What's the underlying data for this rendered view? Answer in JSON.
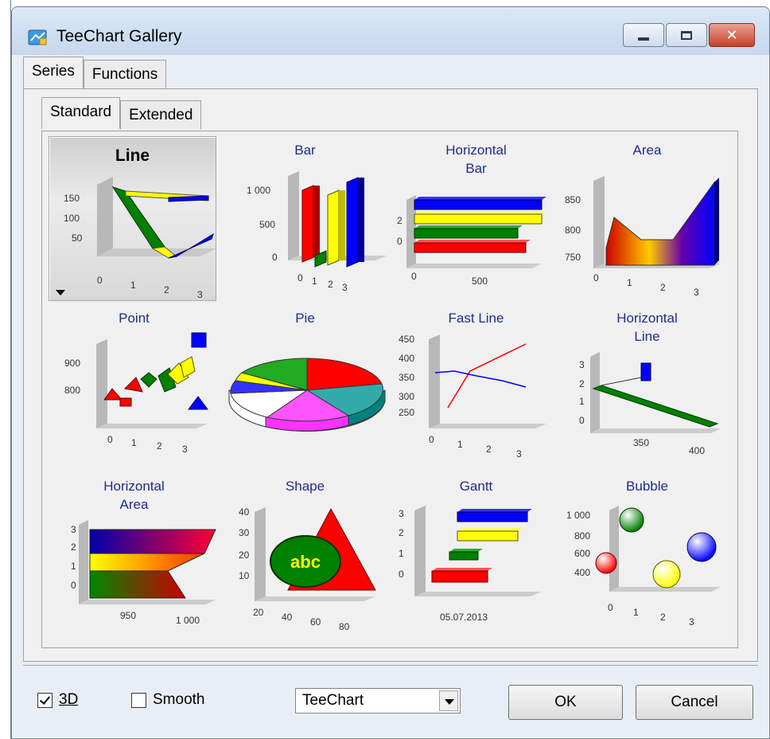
{
  "window": {
    "title": "TeeChart Gallery"
  },
  "caption_buttons": {
    "close": "✕"
  },
  "tabs_main": [
    {
      "label": "Series",
      "active": true
    },
    {
      "label": "Functions",
      "active": false
    }
  ],
  "tabs_sub": [
    {
      "label": "Standard",
      "active": true
    },
    {
      "label": "Extended",
      "active": false
    }
  ],
  "gallery": [
    {
      "name": "Line",
      "selected": true
    },
    {
      "name": "Bar"
    },
    {
      "name": "Horizontal\nBar"
    },
    {
      "name": "Area"
    },
    {
      "name": "Point"
    },
    {
      "name": "Pie"
    },
    {
      "name": "Fast Line"
    },
    {
      "name": "Horizontal\nLine"
    },
    {
      "name": "Horizontal\nArea"
    },
    {
      "name": "Shape"
    },
    {
      "name": "Gantt"
    },
    {
      "name": "Bubble"
    }
  ],
  "thumb_labels": {
    "line": {
      "y": [
        "150",
        "100",
        "50"
      ],
      "x": [
        "0",
        "1",
        "2",
        "3"
      ]
    },
    "bar": {
      "y": [
        "1 000",
        "500",
        "0"
      ],
      "x": [
        "0",
        "1",
        "2",
        "3"
      ]
    },
    "hbar": {
      "y": [
        "2",
        "0"
      ],
      "x": [
        "0",
        "500"
      ]
    },
    "area": {
      "y": [
        "850",
        "800",
        "750"
      ],
      "x": [
        "0",
        "1",
        "2",
        "3"
      ]
    },
    "point": {
      "y": [
        "900",
        "800"
      ],
      "x": [
        "0",
        "1",
        "2",
        "3"
      ]
    },
    "fastline": {
      "y": [
        "450",
        "400",
        "350",
        "300",
        "250"
      ],
      "x": [
        "0",
        "1",
        "2",
        "3"
      ]
    },
    "hline": {
      "y": [
        "3",
        "2",
        "1",
        "0"
      ],
      "x": [
        "350",
        "400"
      ]
    },
    "harea": {
      "y": [
        "3",
        "2",
        "1",
        "0"
      ],
      "x": [
        "950",
        "1 000"
      ]
    },
    "shape": {
      "y": [
        "40",
        "30",
        "20",
        "10"
      ],
      "x": [
        "20",
        "40",
        "60",
        "80"
      ],
      "text": "abc"
    },
    "gantt": {
      "y": [
        "3",
        "2",
        "1",
        "0"
      ],
      "x": [
        "05.07.2013"
      ]
    },
    "bubble": {
      "y": [
        "1 000",
        "800",
        "600",
        "400"
      ],
      "x": [
        "0",
        "1",
        "2",
        "3"
      ]
    }
  },
  "options": {
    "three_d": {
      "label": "3D",
      "checked": true
    },
    "smooth": {
      "label": "Smooth",
      "checked": false
    },
    "style_select": {
      "value": "TeeChart"
    }
  },
  "buttons": {
    "ok": "OK",
    "cancel": "Cancel"
  },
  "colors": {
    "title_blue": "#1f2d86",
    "red": "#ff0000",
    "green": "#008000",
    "yellow": "#ffff00",
    "blue": "#0000ff"
  }
}
